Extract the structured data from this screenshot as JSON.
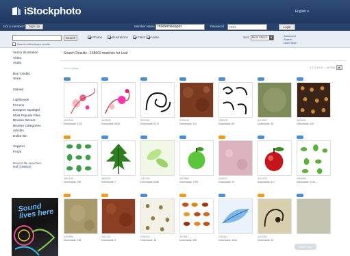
{
  "header": {
    "logo_text": "iStockphoto",
    "language": "English ▾",
    "new_account_label": "Not a member?",
    "signup_label": "Sign Up",
    "member_name_label": "Member Name",
    "member_name_value": "modernkeppet",
    "password_label": "Password",
    "password_value": "••••••",
    "login_label": "Login"
  },
  "search": {
    "input_value": "",
    "button_label": "Search",
    "filters": [
      {
        "label": "Photos",
        "checked": true
      },
      {
        "label": "Illustrations",
        "checked": true
      },
      {
        "label": "Flash",
        "checked": true
      },
      {
        "label": "Video",
        "checked": true
      }
    ],
    "sort_label": "Sort",
    "sort_value": "Best Match",
    "advanced_label": "Advanced Search",
    "help_label": "Need help?",
    "within_label": "Search within these results"
  },
  "sidebar": {
    "group1": [
      "Vector Illustration",
      "Video",
      "Audio"
    ],
    "group2": [
      "Buy Credits",
      "Store"
    ],
    "group3": [
      "Upload"
    ],
    "group4": [
      "Lightboxes",
      "Forums",
      "Designer Spotlight",
      "Most Popular Files",
      "Browse Recent",
      "Browse Categories",
      "Articles",
      "Dollar Bin"
    ],
    "group5": [
      "Support",
      "FAQs"
    ],
    "recent_label": "Recent file searches:",
    "recent_value": "leaf (158602)"
  },
  "ad": {
    "text": "Sound lives here"
  },
  "results": {
    "title": "Search Results : 158602 matches for Leaf",
    "view_label": "View a page",
    "pager_text": "1 2 3 4 5 6 ... of 7931",
    "pager_next": "▸",
    "next_button": "Next Page",
    "tiles": [
      {
        "badge": "photo",
        "caption": "4523108",
        "downloads": "Downloads: 5702",
        "art": "floral-swirl"
      },
      {
        "badge": "photo",
        "caption": "4629828",
        "downloads": "Downloads: 6836",
        "art": "floral-pink"
      },
      {
        "badge": "photo",
        "caption": "5221166",
        "downloads": "Downloads: 6770",
        "art": "swirl-ornament"
      },
      {
        "badge": "photo",
        "caption": "9784106",
        "downloads": "Downloads: 114",
        "art": "brown-texture"
      },
      {
        "badge": "photo",
        "caption": "2959276",
        "downloads": "Downloads: 65",
        "art": "swirl-set"
      },
      {
        "badge": "photo",
        "caption": "4414520",
        "downloads": "Downloads: 15",
        "art": "green-texture"
      },
      {
        "badge": "photo",
        "caption": "4628290",
        "downloads": "Downloads: 240",
        "art": "dark-dots"
      },
      {
        "badge": "illus",
        "caption": "4597128",
        "downloads": "Downloads: 168",
        "art": "leaf-icons"
      },
      {
        "badge": "photo",
        "caption": "4638115",
        "downloads": "Downloads: 2",
        "art": "green-leaf"
      },
      {
        "badge": "photo",
        "caption": "4767193",
        "downloads": "Downloads: 6289",
        "art": "light-leaves"
      },
      {
        "badge": "photo",
        "caption": "4412888",
        "downloads": "Downloads: 1765",
        "art": "apple-icon"
      },
      {
        "badge": "illus",
        "caption": "4405471",
        "downloads": "Downloads: 29",
        "art": "pink-texture"
      },
      {
        "badge": "photo",
        "caption": "4412478",
        "downloads": "Downloads: 317",
        "art": "red-apple"
      },
      {
        "badge": "photo",
        "caption": "4362666",
        "downloads": "Downloads: 2415",
        "art": "leaf-silhouettes"
      },
      {
        "badge": "illus",
        "caption": "4320981",
        "downloads": "Downloads: 148",
        "art": "beige-texture"
      },
      {
        "badge": "illus",
        "caption": "4411220",
        "downloads": "Downloads: 9",
        "art": "rust-texture"
      },
      {
        "badge": "photo",
        "caption": "4766124",
        "downloads": "Downloads: 18",
        "art": "dotted-pattern"
      },
      {
        "badge": "illus",
        "caption": "4475617",
        "downloads": "Downloads: 328",
        "art": "autumn-leaves"
      },
      {
        "badge": "photo",
        "caption": "4383114",
        "downloads": "Downloads: 1624",
        "art": "blue-leaf"
      },
      {
        "badge": "illus",
        "caption": "4415291",
        "downloads": "Downloads: 15",
        "art": "grunge-swirl"
      },
      {
        "badge": "photo",
        "caption": "",
        "downloads": "",
        "art": "plain-sage"
      }
    ]
  },
  "colors": {
    "header_bg": "#1f3a63",
    "photo_badge": "#4a8fd8",
    "illus_badge": "#f39a1e",
    "link": "#1c2d4b"
  }
}
